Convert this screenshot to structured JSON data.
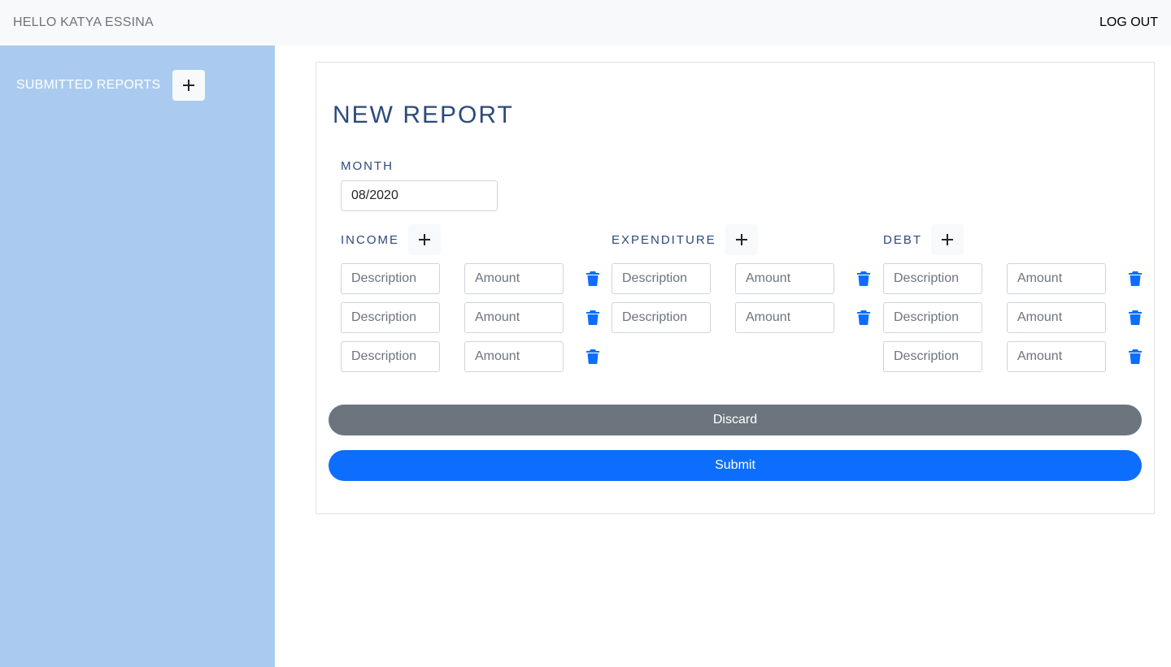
{
  "header": {
    "greeting": "HELLO KATYA ESSINA",
    "logout_label": "LOG OUT"
  },
  "sidebar": {
    "label": "SUBMITTED REPORTS",
    "add_icon": "plus-icon"
  },
  "form": {
    "title": "NEW REPORT",
    "month_label": "MONTH",
    "month_value": "08/2020",
    "sections": [
      {
        "label": "INCOME",
        "rows": [
          {
            "description_placeholder": "Description",
            "amount_placeholder": "Amount"
          },
          {
            "description_placeholder": "Description",
            "amount_placeholder": "Amount"
          },
          {
            "description_placeholder": "Description",
            "amount_placeholder": "Amount"
          }
        ]
      },
      {
        "label": "EXPENDITURE",
        "rows": [
          {
            "description_placeholder": "Description",
            "amount_placeholder": "Amount"
          },
          {
            "description_placeholder": "Description",
            "amount_placeholder": "Amount"
          }
        ]
      },
      {
        "label": "DEBT",
        "rows": [
          {
            "description_placeholder": "Description",
            "amount_placeholder": "Amount"
          },
          {
            "description_placeholder": "Description",
            "amount_placeholder": "Amount"
          },
          {
            "description_placeholder": "Description",
            "amount_placeholder": "Amount"
          }
        ]
      }
    ],
    "discard_label": "Discard",
    "submit_label": "Submit"
  },
  "colors": {
    "sidebar_bg": "#aacbef",
    "title": "#2c4a7c",
    "primary": "#0d6efd",
    "secondary": "#6c757d"
  },
  "icons": {
    "add": "plus-icon",
    "delete": "trash-icon"
  }
}
